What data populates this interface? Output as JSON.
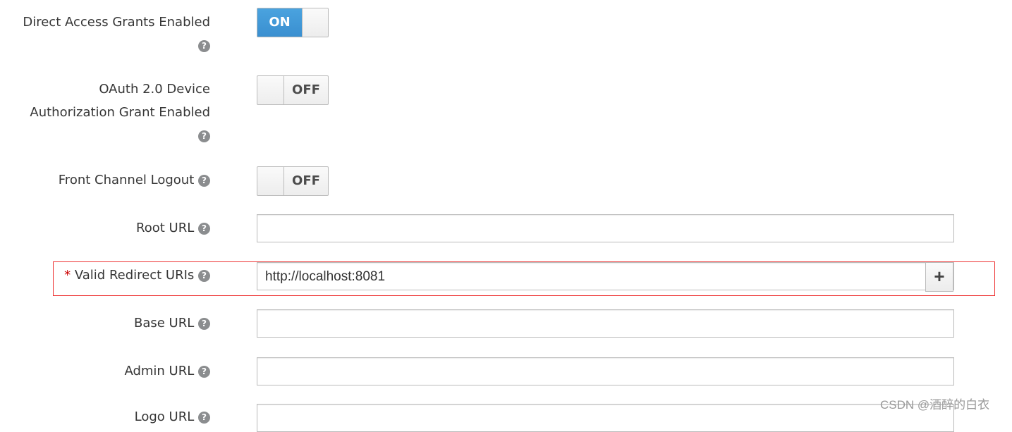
{
  "fields": {
    "direct_access": {
      "label": "Direct Access Grants Enabled",
      "state": "ON"
    },
    "device_grant": {
      "label1": "OAuth 2.0 Device",
      "label2": "Authorization Grant Enabled",
      "state": "OFF"
    },
    "front_channel": {
      "label": "Front Channel Logout",
      "state": "OFF"
    },
    "root_url": {
      "label": "Root URL",
      "value": ""
    },
    "redirect_uris": {
      "required": "*",
      "label": "Valid Redirect URIs",
      "value": "http://localhost:8081",
      "add": "+"
    },
    "base_url": {
      "label": "Base URL",
      "value": ""
    },
    "admin_url": {
      "label": "Admin URL",
      "value": ""
    },
    "logo_url": {
      "label": "Logo URL",
      "value": ""
    }
  },
  "help_glyph": "?",
  "watermark": "CSDN @酒醉的白衣",
  "colors": {
    "toggle_on": "#3a8fd0",
    "highlight": "#e33333"
  }
}
